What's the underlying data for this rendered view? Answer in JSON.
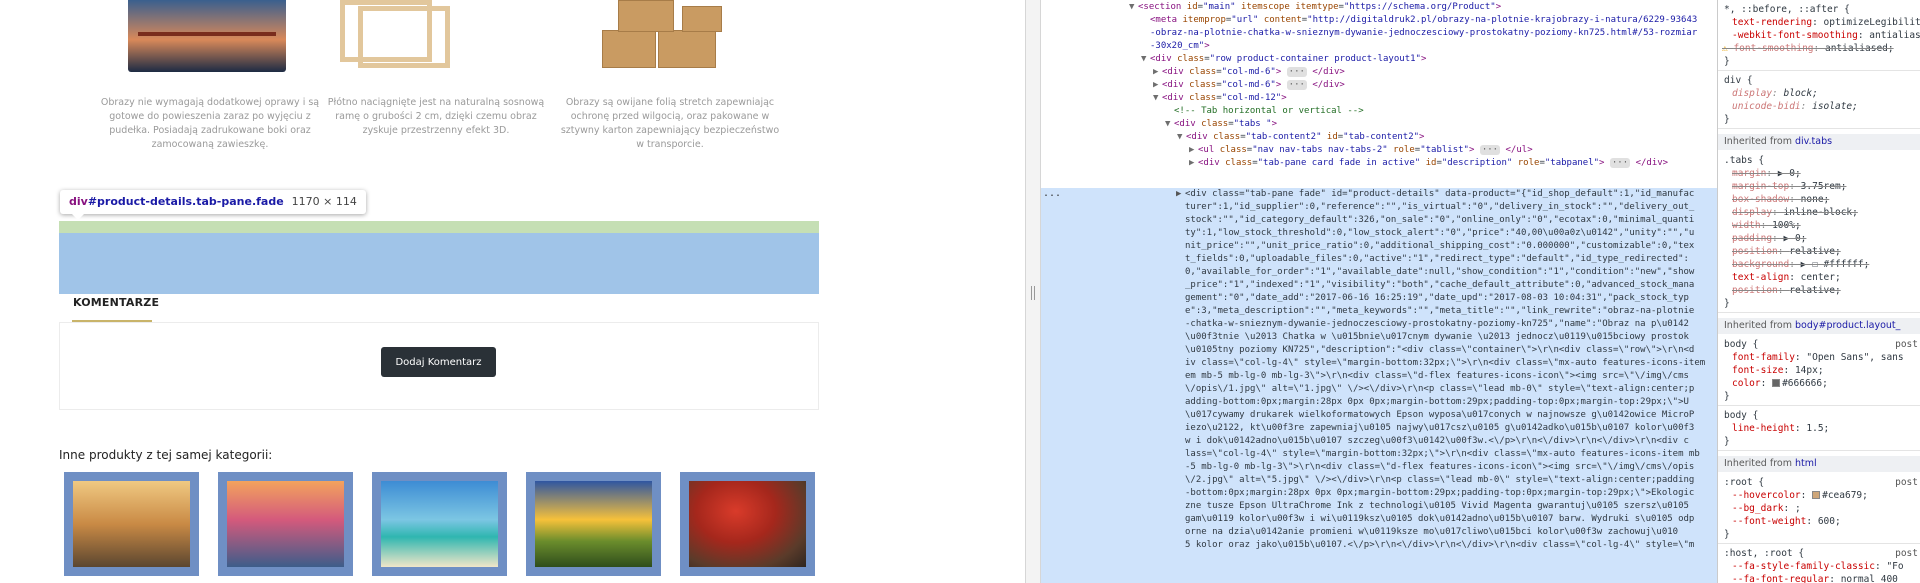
{
  "page": {
    "features": [
      {
        "text": "Obrazy nie wymagają dodatkowej oprawy i są gotowe do powieszenia zaraz po wyjęciu z pudełka. Posiadają zadrukowane boki oraz zamocowaną zawieszkę.",
        "image_icon": "canvas-bridge-image"
      },
      {
        "text": "Płótno naciągnięte jest na naturalną sosnową ramę o grubości 2 cm, dzięki czemu obraz zyskuje przestrzenny efekt 3D.",
        "image_icon": "wooden-frames-image"
      },
      {
        "text": "Obrazy są owijane folią stretch zapewniając ochronę przed wilgocią, oraz pakowane w sztywny karton zapewniający bezpieczeństwo w transporcie.",
        "image_icon": "cardboard-boxes-image"
      }
    ],
    "tooltip": {
      "tag": "div",
      "selector": "#product-details.tab-pane.fade",
      "size": "1170 × 114"
    },
    "comments": {
      "title": "KOMENTARZE",
      "button": "Dodaj Komentarz"
    },
    "other_products": {
      "title": "Inne produkty z tej samej kategorii:",
      "thumbs": [
        "windmills-thumbnail",
        "venice-gondolas-thumbnail",
        "beach-thumbnail",
        "sunset-field-thumbnail",
        "red-tree-thumbnail"
      ]
    },
    "colors": {
      "highlight_content": "#a0c4e8",
      "highlight_margin": "#c5dfb4",
      "button_bg": "#2a3137",
      "accent_line": "#c9b46a"
    }
  },
  "elements": {
    "lines": [
      {
        "indent": 7,
        "arrow": "▼",
        "html": "<span class=\"t\">&lt;section</span> <span class=\"a\">id</span>=<span class=\"v\">\"main\"</span> <span class=\"a\">itemscope</span> <span class=\"a\">itemtype</span>=<span class=\"v\">\"https://schema.org/Product\"</span><span class=\"t\">&gt;</span>"
      },
      {
        "indent": 8,
        "arrow": "",
        "html": "<span class=\"t\">&lt;meta</span> <span class=\"a\">itemprop</span>=<span class=\"v\">\"url\"</span> <span class=\"a\">content</span>=<span class=\"v\">\"http://digitaldruk2.pl/obrazy-na-plotnie-krajobrazy-i-natura/6229-93643</span>"
      },
      {
        "indent": 8,
        "arrow": "",
        "html": "<span class=\"v\">-obraz-na-plotnie-chatka-w-snieznym-dywanie-jednoczesciowy-prostokatny-poziomy-kn725.html#/53-rozmiar</span>"
      },
      {
        "indent": 8,
        "arrow": "",
        "html": "<span class=\"v\">-30x20_cm\"</span><span class=\"t\">&gt;</span>"
      },
      {
        "indent": 8,
        "arrow": "▼",
        "html": "<span class=\"t\">&lt;div</span> <span class=\"a\">class</span>=<span class=\"v\">\"row product-container product-layout1\"</span><span class=\"t\">&gt;</span>"
      },
      {
        "indent": 9,
        "arrow": "▶",
        "html": "<span class=\"t\">&lt;div</span> <span class=\"a\">class</span>=<span class=\"v\">\"col-md-6\"</span><span class=\"t\">&gt;</span> <span class=\"ell\">···</span> <span class=\"t\">&lt;/div&gt;</span>"
      },
      {
        "indent": 9,
        "arrow": "▶",
        "html": "<span class=\"t\">&lt;div</span> <span class=\"a\">class</span>=<span class=\"v\">\"col-md-6\"</span><span class=\"t\">&gt;</span> <span class=\"ell\">···</span> <span class=\"t\">&lt;/div&gt;</span>"
      },
      {
        "indent": 9,
        "arrow": "▼",
        "html": "<span class=\"t\">&lt;div</span> <span class=\"a\">class</span>=<span class=\"v\">\"col-md-12\"</span><span class=\"t\">&gt;</span>"
      },
      {
        "indent": 10,
        "arrow": "",
        "html": "<span class=\"c\">&lt;!-- Tab horizontal or vertical --&gt;</span>"
      },
      {
        "indent": 10,
        "arrow": "▼",
        "html": "<span class=\"t\">&lt;div</span> <span class=\"a\">class</span>=<span class=\"v\">\"tabs \"</span><span class=\"t\">&gt;</span>"
      },
      {
        "indent": 11,
        "arrow": "▼",
        "html": "<span class=\"t\">&lt;div</span> <span class=\"a\">class</span>=<span class=\"v\">\"tab-content2\"</span> <span class=\"a\">id</span>=<span class=\"v\">\"tab-content2\"</span><span class=\"t\">&gt;</span>"
      },
      {
        "indent": 12,
        "arrow": "▶",
        "html": "<span class=\"t\">&lt;ul</span> <span class=\"a\">class</span>=<span class=\"v\">\"nav nav-tabs nav-tabs-2\"</span> <span class=\"a\">role</span>=<span class=\"v\">\"tablist\"</span><span class=\"t\">&gt;</span> <span class=\"ell\">···</span> <span class=\"t\">&lt;/ul&gt;</span>"
      },
      {
        "indent": 12,
        "arrow": "▶",
        "html": "<span class=\"t\">&lt;div</span> <span class=\"a\">class</span>=<span class=\"v\">\"tab-pane card fade in active\"</span> <span class=\"a\">id</span>=<span class=\"v\">\"description\"</span> <span class=\"a\">role</span>=<span class=\"v\">\"tabpanel\"</span><span class=\"t\">&gt;</span> <span class=\"ell\">···</span> <span class=\"t\">&lt;/div&gt;</span>"
      }
    ],
    "selected_lines": [
      "<div class=\"tab-pane fade\" id=\"product-details\" data-product=\"{\"id_shop_default\":1,\"id_manufac",
      "turer\":1,\"id_supplier\":0,\"reference\":\"\",\"is_virtual\":\"0\",\"delivery_in_stock\":\"\",\"delivery_out_",
      "stock\":\"\",\"id_category_default\":326,\"on_sale\":\"0\",\"online_only\":\"0\",\"ecotax\":0,\"minimal_quanti",
      "ty\":1,\"low_stock_threshold\":0,\"low_stock_alert\":\"0\",\"price\":\"40,00\\u00a0z\\u0142\",\"unity\":\"\",\"u",
      "nit_price\":\"\",\"unit_price_ratio\":0,\"additional_shipping_cost\":\"0.000000\",\"customizable\":0,\"tex",
      "t_fields\":0,\"uploadable_files\":0,\"active\":\"1\",\"redirect_type\":\"default\",\"id_type_redirected\":",
      "0,\"available_for_order\":\"1\",\"available_date\":null,\"show_condition\":\"1\",\"condition\":\"new\",\"show",
      "_price\":\"1\",\"indexed\":\"1\",\"visibility\":\"both\",\"cache_default_attribute\":0,\"advanced_stock_mana",
      "gement\":\"0\",\"date_add\":\"2017-06-16 16:25:19\",\"date_upd\":\"2017-08-03 10:04:31\",\"pack_stock_typ",
      "e\":3,\"meta_description\":\"\",\"meta_keywords\":\"\",\"meta_title\":\"\",\"link_rewrite\":\"obraz-na-plotnie",
      "-chatka-w-snieznym-dywanie-jednoczesciowy-prostokatny-poziomy-kn725\",\"name\":\"Obraz na p\\u0142",
      "\\u00f3tnie \\u2013 Chatka w \\u015bnie\\u017cnym dywanie \\u2013 jednocz\\u0119\\u015bciowy prostok",
      "\\u0105tny poziomy KN725\",\"description\":\"<div class=\\\"container\\\">\\r\\n<div class=\\\"row\\\">\\r\\n<d",
      "iv class=\\\"col-lg-4\\\" style=\\\"margin-bottom:32px;\\\">\\r\\n<div class=\\\"mx-auto features-icons-item",
      "em mb-5 mb-lg-0 mb-lg-3\\\">\\r\\n<div class=\\\"d-flex features-icons-icon\\\"><img src=\\\"\\/img\\/cms",
      "\\/opis\\/1.jpg\\\" alt=\\\"1.jpg\\\" \\/><\\/div>\\r\\n<p class=\\\"lead mb-0\\\" style=\\\"text-align:center;p",
      "adding-bottom:0px;margin:28px 0px 0px;margin-bottom:29px;padding-top:0px;margin-top:29px;\\\">U",
      "\\u017cywamy drukarek wielkoformatowych Epson wyposa\\u017conych w najnowsze g\\u0142owice MicroP",
      "iezo\\u2122, kt\\u00f3re zapewniaj\\u0105 najwy\\u017csz\\u0105 g\\u0142adko\\u015b\\u0107 kolor\\u00f3",
      "w i dok\\u0142adno\\u015b\\u0107 szczeg\\u00f3\\u0142\\u00f3w.<\\/p>\\r\\n<\\/div>\\r\\n<\\/div>\\r\\n<div c",
      "lass=\\\"col-lg-4\\\" style=\\\"margin-bottom:32px;\\\">\\r\\n<div class=\\\"mx-auto features-icons-item mb",
      "-5 mb-lg-0 mb-lg-3\\\">\\r\\n<div class=\\\"d-flex features-icons-icon\\\"><img src=\\\"\\/img\\/cms\\/opis",
      "\\/2.jpg\\\" alt=\\\"5.jpg\\\" \\/><\\/div>\\r\\n<p class=\\\"lead mb-0\\\" style=\\\"text-align:center;padding",
      "-bottom:0px;margin:28px 0px 0px;margin-bottom:29px;padding-top:0px;margin-top:29px;\\\">Ekologic",
      "zne tusze Epson UltraChrome Ink z technologi\\u0105 Vivid Magenta gwarantuj\\u0105 szersz\\u0105",
      "gam\\u0119 kolor\\u00f3w i wi\\u0119ksz\\u0105 dok\\u0142adno\\u015b\\u0107 barw. Wydruki s\\u0105 odp",
      "orne na dzia\\u0142anie promieni w\\u0119ksze mo\\u017cliwo\\u015bci kolor\\u00f3w zachowuj\\u010",
      "5 kolor oraz jako\\u015b\\u0107.<\\/p>\\r\\n<\\/div>\\r\\n<\\/div>\\r\\n<div class=\\\"col-lg-4\\\" style=\\\"m"
    ],
    "selected_gutter": "..."
  },
  "styles": {
    "rules": [
      {
        "kind": "rule",
        "text": "*, ::before, ::after {"
      },
      {
        "kind": "prop",
        "prop": "text-rendering",
        "value": "optimizeLegibility;"
      },
      {
        "kind": "prop",
        "prop": "-webkit-font-smoothing",
        "value": "antialiased;"
      },
      {
        "kind": "warnstrike",
        "prop": "font-smoothing",
        "value": "antialiased;"
      },
      {
        "kind": "close",
        "text": "}"
      },
      {
        "kind": "rule",
        "text": "div {"
      },
      {
        "kind": "italic",
        "prop": "display",
        "value": "block;"
      },
      {
        "kind": "italic",
        "prop": "unicode-bidi",
        "value": "isolate;"
      },
      {
        "kind": "close",
        "text": "}"
      },
      {
        "kind": "inherit",
        "label": "Inherited from",
        "target": "div.tabs"
      },
      {
        "kind": "rule",
        "text": ".tabs {"
      },
      {
        "kind": "strike",
        "prop": "margin",
        "value": "▶ 0;"
      },
      {
        "kind": "strike",
        "prop": "margin-top",
        "value": "3.75rem;"
      },
      {
        "kind": "strike",
        "prop": "box-shadow",
        "value": "none;"
      },
      {
        "kind": "strike",
        "prop": "display",
        "value": "inline-block;"
      },
      {
        "kind": "strike",
        "prop": "width",
        "value": "100%;"
      },
      {
        "kind": "strike",
        "prop": "padding",
        "value": "▶ 0;"
      },
      {
        "kind": "strike",
        "prop": "position",
        "value": "relative;"
      },
      {
        "kind": "strike",
        "prop": "background",
        "value": "▶ ☐ #ffffff;"
      },
      {
        "kind": "prop",
        "prop": "text-align",
        "value": "center;"
      },
      {
        "kind": "strike",
        "prop": "position",
        "value": "relative;"
      },
      {
        "kind": "close",
        "text": "}"
      },
      {
        "kind": "inherit",
        "label": "Inherited from",
        "target": "body#product.layout_"
      },
      {
        "kind": "rulesrc",
        "text": "body {",
        "src": "post"
      },
      {
        "kind": "prop",
        "prop": "font-family",
        "value": "\"Open Sans\", sans"
      },
      {
        "kind": "prop",
        "prop": "font-size",
        "value": "14px;"
      },
      {
        "kind": "propswatch",
        "prop": "color",
        "value": "#666666;",
        "swatch": "#666666"
      },
      {
        "kind": "close",
        "text": "}"
      },
      {
        "kind": "rule",
        "text": "body {"
      },
      {
        "kind": "prop",
        "prop": "line-height",
        "value": "1.5;"
      },
      {
        "kind": "close",
        "text": "}"
      },
      {
        "kind": "inherit",
        "label": "Inherited from",
        "target": "html"
      },
      {
        "kind": "rulesrc",
        "text": ":root {",
        "src": "post"
      },
      {
        "kind": "propswatch",
        "prop": "--hovercolor",
        "value": "#cea679;",
        "swatch": "#cea679"
      },
      {
        "kind": "prop",
        "prop": "--bg_dark",
        "value": ";"
      },
      {
        "kind": "prop",
        "prop": "--font-weight",
        "value": "600;"
      },
      {
        "kind": "close",
        "text": "}"
      },
      {
        "kind": "rulesrc",
        "text": ":host, :root {",
        "src": "post"
      },
      {
        "kind": "prop",
        "prop": "--fa-style-family-classic",
        "value": "\"Fo"
      },
      {
        "kind": "prop",
        "prop": "--fa-font-regular",
        "value": "normal 400"
      }
    ]
  }
}
